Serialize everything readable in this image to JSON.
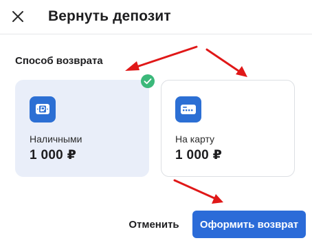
{
  "dialog": {
    "title": "Вернуть депозит",
    "close_icon": "close-icon"
  },
  "refund_method": {
    "label": "Способ возврата",
    "options": [
      {
        "label": "Наличными",
        "amount": "1 000 ₽",
        "icon": "cash-icon",
        "selected": true
      },
      {
        "label": "На карту",
        "amount": "1 000 ₽",
        "icon": "card-icon",
        "selected": false
      }
    ]
  },
  "footer": {
    "cancel_label": "Отменить",
    "submit_label": "Оформить возврат"
  },
  "colors": {
    "accent": "#2B6BD8",
    "selected_card_bg": "#E9EEF9",
    "check_badge": "#3BB87A",
    "annotation_arrow": "#E01818"
  }
}
